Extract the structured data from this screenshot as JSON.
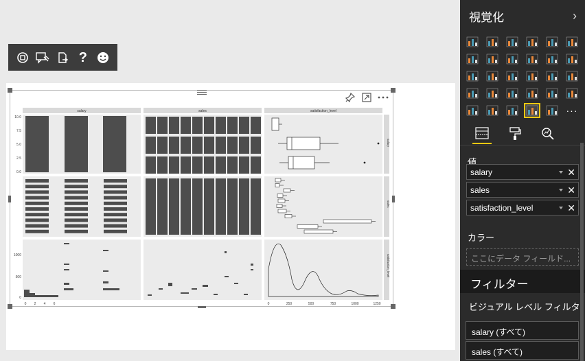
{
  "toolbar": {
    "items": [
      "focus-mode",
      "comment",
      "export",
      "help",
      "feedback"
    ],
    "help_label": "?"
  },
  "visual": {
    "kind": "R-script pairs plot (ggpairs)",
    "icons": [
      "pin-icon",
      "focus-icon",
      "more-icon"
    ],
    "facets": [
      "salary",
      "sales",
      "satisfaction_level"
    ],
    "y_ticks_top": [
      "10.0",
      "7.5",
      "5.0",
      "2.5",
      "0.0"
    ],
    "y_ticks_bottom": [
      "1000",
      "500",
      "0"
    ],
    "x_ticks_salary": [
      "0",
      "2",
      "4",
      "6"
    ],
    "x_ticks_sat": [
      "0",
      "250",
      "500",
      "750",
      "1000",
      "1250"
    ]
  },
  "pane": {
    "title": "視覚化",
    "chevron": "›",
    "values_label": "値",
    "fields": [
      {
        "name": "salary"
      },
      {
        "name": "sales"
      },
      {
        "name": "satisfaction_level"
      }
    ],
    "color_label": "カラー",
    "color_placeholder": "ここにデータ フィールド...",
    "filters_title": "フィルター",
    "visual_filter_label": "ビジュアル レベル フィルタ...",
    "filter_cards": [
      "salary (すべて)",
      "sales (すべて)"
    ]
  },
  "colors": {
    "accent": "#f2c811",
    "pane_bg": "#2b2b2b",
    "bar_orange": "#e8883a",
    "bar_teal": "#4a9bb5"
  }
}
